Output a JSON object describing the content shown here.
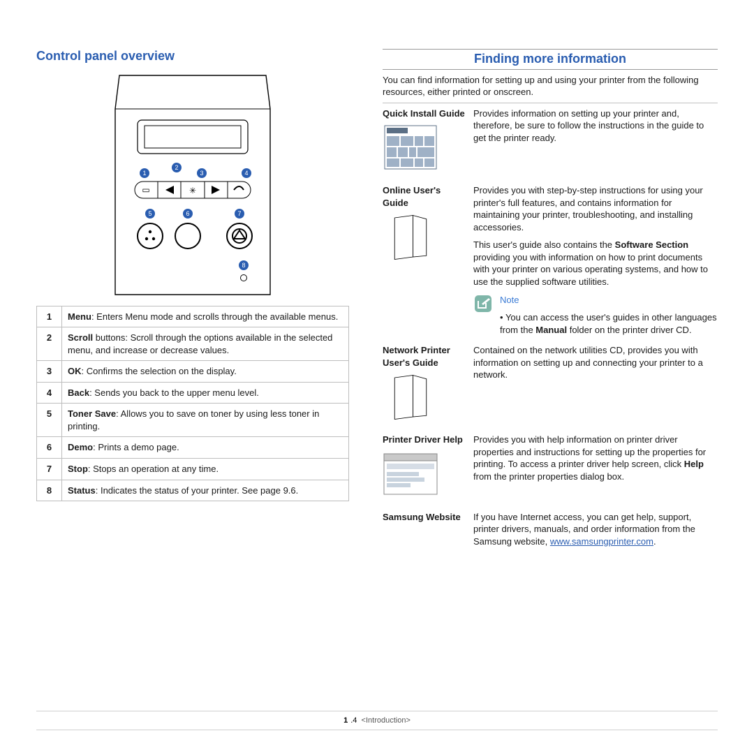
{
  "left": {
    "heading": "Control panel overview",
    "callouts": [
      "1",
      "2",
      "3",
      "4",
      "5",
      "6",
      "7",
      "8"
    ],
    "legend": [
      {
        "n": "1",
        "term": "Menu",
        "desc": ": Enters Menu mode and scrolls through the available menus."
      },
      {
        "n": "2",
        "term": "Scroll",
        "desc": " buttons: Scroll through the options available in the selected menu, and increase or decrease values."
      },
      {
        "n": "3",
        "term": "OK",
        "desc": ": Confirms the selection on the display."
      },
      {
        "n": "4",
        "term": "Back",
        "desc": ": Sends you back to the upper menu level."
      },
      {
        "n": "5",
        "term": "Toner Save",
        "desc": ": Allows you to save on toner by using less toner in printing."
      },
      {
        "n": "6",
        "term": "Demo",
        "desc": ": Prints a demo page."
      },
      {
        "n": "7",
        "term": "Stop",
        "desc": ": Stops an operation at any time."
      },
      {
        "n": "8",
        "term": "Status",
        "desc": ": Indicates the status of your printer. See page 9.6."
      }
    ]
  },
  "right": {
    "heading": "Finding more information",
    "intro": "You can find information for setting up and using your printer from the following resources, either printed or onscreen.",
    "rows": {
      "qig": {
        "title": "Quick Install Guide",
        "text": "Provides information on setting up your printer and, therefore, be sure to follow the instructions in the guide to get the printer ready."
      },
      "oug": {
        "title": "Online User's Guide",
        "p1": "Provides you with step-by-step instructions for using your printer's full features, and contains information for maintaining your printer, troubleshooting, and installing accessories.",
        "p2a": "This user's guide also contains the ",
        "p2b": "Software Section",
        "p2c": " providing you with information on how to print documents with your printer on various operating systems, and how to use the supplied software utilities.",
        "note_label": "Note",
        "note_a": "You can access the user's guides in other languages from the ",
        "note_b": "Manual",
        "note_c": " folder on the printer driver CD."
      },
      "npg": {
        "title": "Network Printer User's Guide",
        "text": "Contained on the network utilities CD, provides you with information on setting up and connecting your printer to a network."
      },
      "pdh": {
        "title": "Printer Driver Help",
        "a": "Provides you with help information on printer driver properties and instructions for setting up the properties for printing. To access a printer driver help screen, click ",
        "b": "Help",
        "c": " from the printer properties dialog box."
      },
      "site": {
        "title": "Samsung Website",
        "text": "If you have Internet access, you can get help, support, printer drivers, manuals, and order information from the Samsung website, ",
        "url_text": "www.samsungprinter.com",
        "tail": "."
      }
    }
  },
  "footer": {
    "page_major": "1",
    "page_minor": ".4",
    "breadcrumb": "<Introduction>"
  }
}
